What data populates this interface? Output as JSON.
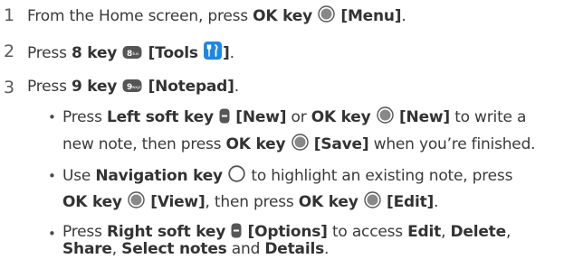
{
  "steps": [
    {
      "number": "1",
      "parts": [
        "From the Home screen, press ",
        "OK key",
        " ",
        "[Menu]",
        "."
      ]
    },
    {
      "number": "2",
      "parts": [
        "Press ",
        "8 key",
        " ",
        "[Tools",
        " ",
        "]",
        "."
      ]
    },
    {
      "number": "3",
      "parts": [
        "Press ",
        "9 key",
        " ",
        "[Notepad]",
        "."
      ]
    }
  ],
  "bullets": [
    {
      "line1": [
        "Press ",
        "Left soft key",
        " ",
        "[New]",
        " or ",
        "OK key",
        " ",
        "[New]",
        " to write a"
      ],
      "line2": [
        "new note, then press ",
        "OK key",
        " ",
        "[Save]",
        " when you’re finished."
      ]
    },
    {
      "line1": [
        "Use ",
        "Navigation key",
        " ",
        "to highlight an existing note, press"
      ],
      "line2": [
        "OK key",
        " ",
        "[View]",
        ", then press ",
        "OK key",
        " ",
        "[Edit]",
        "."
      ]
    },
    {
      "line1": [
        "Press ",
        "Right soft key",
        " ",
        "[Options]",
        " to access ",
        "Edit",
        ", ",
        "Delete",
        ","
      ],
      "line2": [
        "Share",
        ", ",
        "Select notes",
        " and ",
        "Details",
        "."
      ]
    }
  ],
  "icons": {
    "ok_key": "ok-key-icon",
    "eight_key": "eight-key-icon",
    "tools": "tools-icon",
    "nine_key": "nine-key-icon",
    "soft_key": "soft-key-icon",
    "navigation_key": "navigation-key-icon",
    "tools_color": "#1e88e5",
    "key_color": "#555555"
  }
}
